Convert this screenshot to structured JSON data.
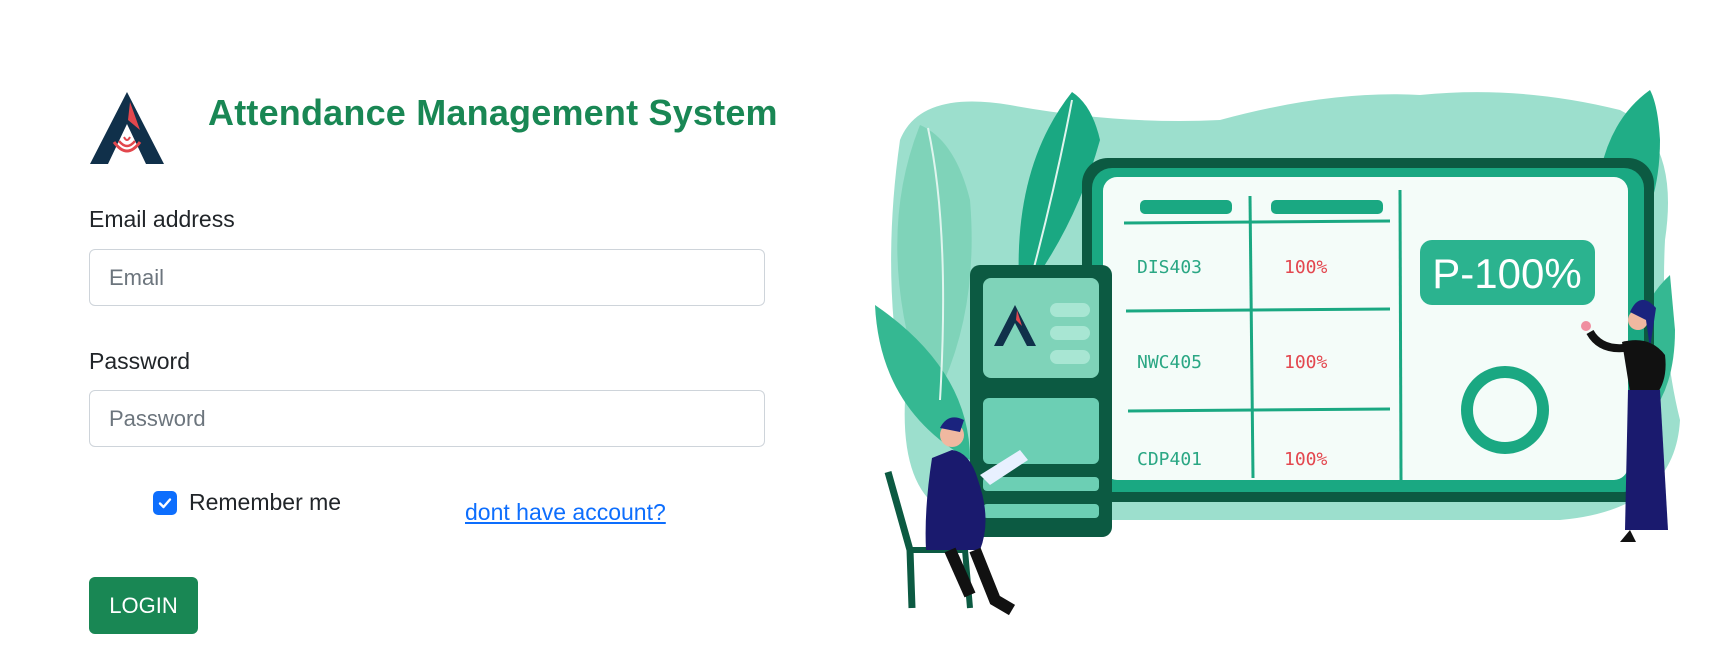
{
  "app": {
    "title": "Attendance Management System"
  },
  "form": {
    "email_label": "Email address",
    "email_placeholder": "Email",
    "email_value": "",
    "password_label": "Password",
    "password_placeholder": "Password",
    "password_value": "",
    "remember_label": "Remember me",
    "remember_checked": true,
    "signup_link": "dont have account?",
    "login_button": "LOGIN"
  },
  "illustration": {
    "rows": [
      {
        "code": "DIS403",
        "percent": "100%"
      },
      {
        "code": "NWC405",
        "percent": "100%"
      },
      {
        "code": "CDP401",
        "percent": "100%"
      }
    ],
    "badge": "P-100%"
  },
  "colors": {
    "brand_green": "#198754",
    "link_blue": "#0d6efd",
    "checkbox_blue": "#0d6efd",
    "logo_navy": "#10304a",
    "logo_red": "#e2474d",
    "illustration_teal": "#1aa882"
  },
  "icons": {
    "logo": "app-logo-icon",
    "checkbox": "checkmark-icon"
  }
}
